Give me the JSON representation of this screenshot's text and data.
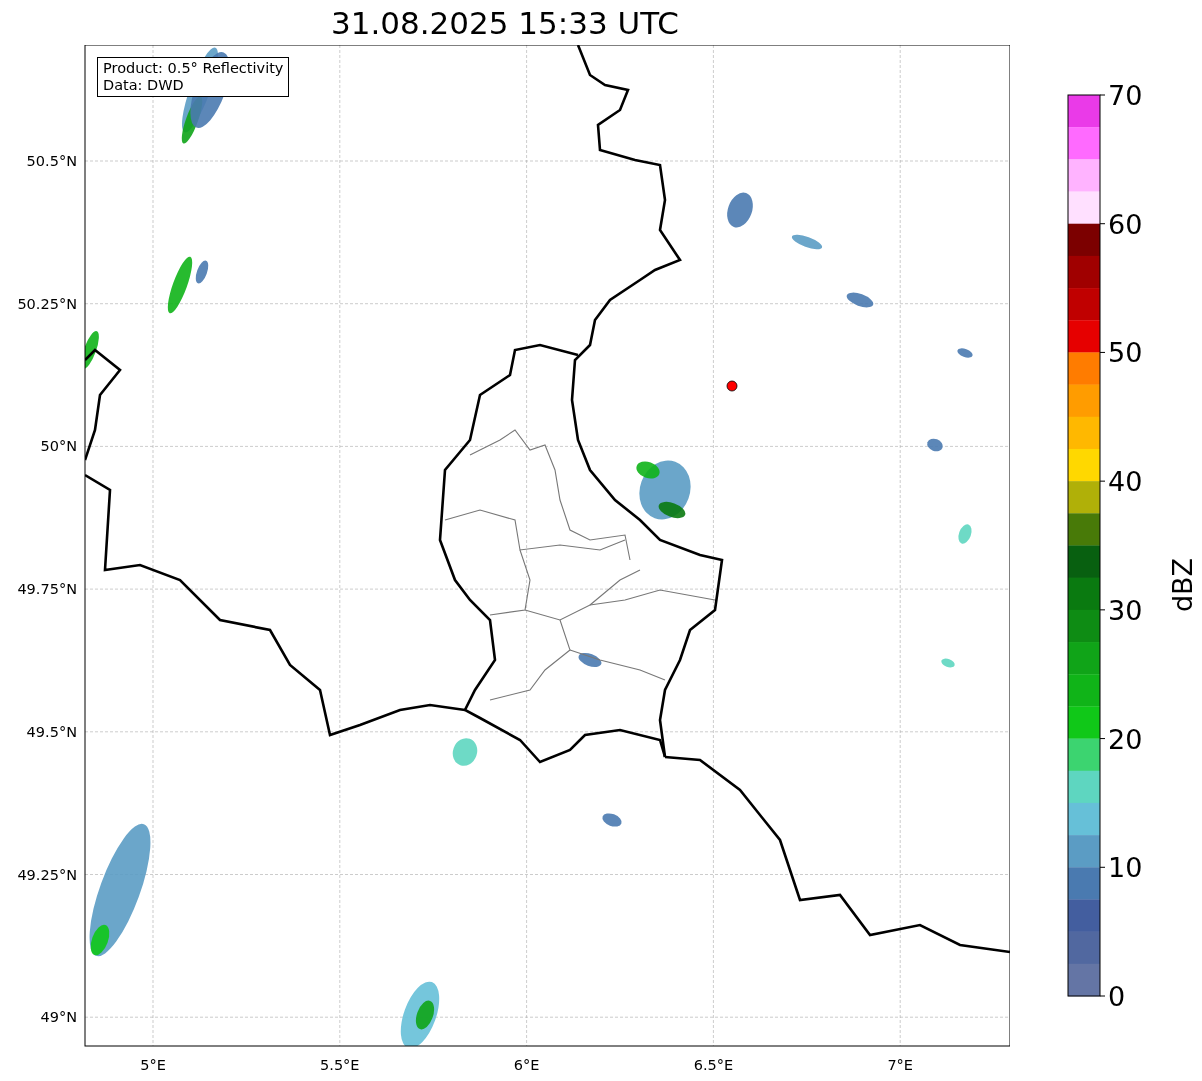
{
  "title": "31.08.2025 15:33 UTC",
  "legend": [
    "Product: 0.5° Reflectivity",
    "Data: DWD"
  ],
  "x_ticks": [
    "5°E",
    "5.5°E",
    "6°E",
    "6.5°E",
    "7°E"
  ],
  "y_ticks": [
    "50.5°N",
    "50.25°N",
    "50°N",
    "49.75°N",
    "49.5°N",
    "49.25°N",
    "49°N"
  ],
  "colorbar": {
    "label": "dBZ",
    "ticks": [
      "70",
      "60",
      "50",
      "40",
      "30",
      "20",
      "10",
      "0"
    ],
    "bins": [
      {
        "color": "#ea3ae8"
      },
      {
        "color": "#ff6aff"
      },
      {
        "color": "#ffb3ff"
      },
      {
        "color": "#ffe0ff"
      },
      {
        "color": "#7c0000"
      },
      {
        "color": "#a00000"
      },
      {
        "color": "#c00000"
      },
      {
        "color": "#e60000"
      },
      {
        "color": "#ff7c00"
      },
      {
        "color": "#ff9c00"
      },
      {
        "color": "#ffb800"
      },
      {
        "color": "#ffd800"
      },
      {
        "color": "#b0b008"
      },
      {
        "color": "#487a08"
      },
      {
        "color": "#086010"
      },
      {
        "color": "#0a7a10"
      },
      {
        "color": "#0e8c14"
      },
      {
        "color": "#10a418"
      },
      {
        "color": "#10b418"
      },
      {
        "color": "#10c818"
      },
      {
        "color": "#3cd470"
      },
      {
        "color": "#5ed6c0"
      },
      {
        "color": "#66c0d8"
      },
      {
        "color": "#5b9cc4"
      },
      {
        "color": "#4a7ab0"
      },
      {
        "color": "#435e9f"
      },
      {
        "color": "#5168a0"
      },
      {
        "color": "#6475a5"
      }
    ]
  }
}
